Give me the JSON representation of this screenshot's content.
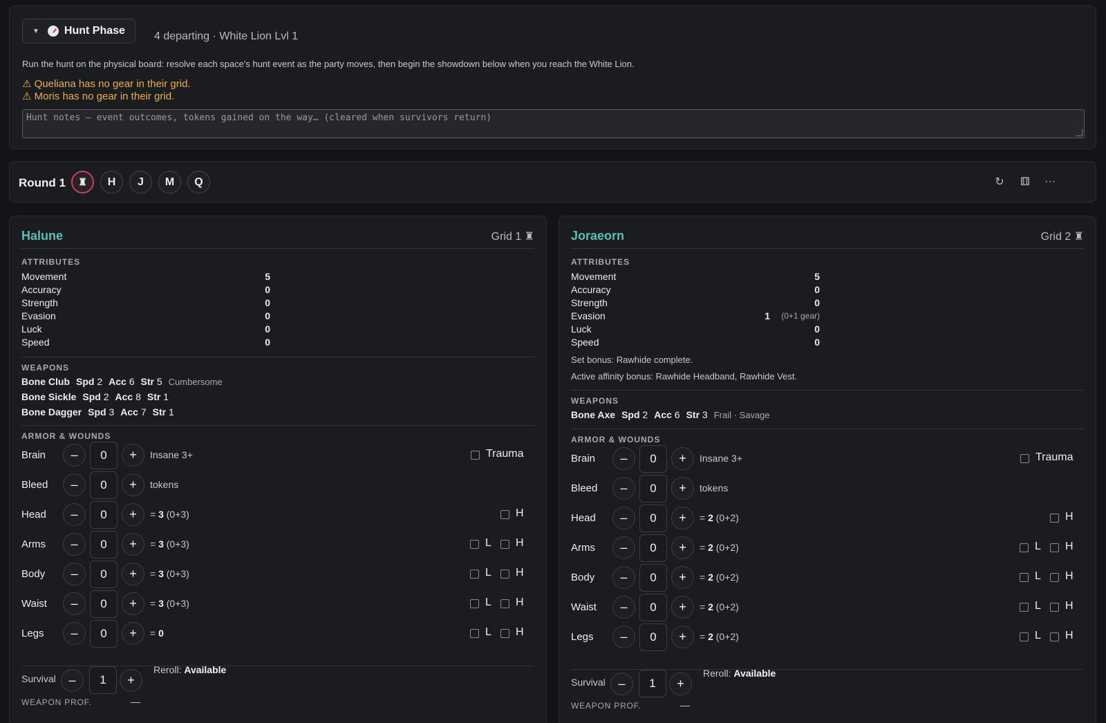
{
  "hunt": {
    "title": "Hunt Phase",
    "subtitle": "4 departing · White Lion Lvl 1",
    "description": "Run the hunt on the physical board: resolve each space's hunt event as the party moves, then begin the showdown below when you reach the White Lion.",
    "warnings": [
      "⚠ Queliana has no gear in their grid.",
      "⚠ Moris has no gear in their grid."
    ],
    "notes_placeholder": "Hunt notes — event outcomes, tokens gained on the way… (cleared when survivors return)"
  },
  "round": {
    "label": "Round 1",
    "chips": [
      "♜",
      "H",
      "J",
      "M",
      "Q"
    ],
    "icons": {
      "undo": "↻",
      "dice": "⚅",
      "more": "···"
    }
  },
  "labels": {
    "attributes": "ATTRIBUTES",
    "weapons": "WEAPONS",
    "armor": "ARMOR & WOUNDS",
    "survival": "Survival",
    "reroll": "Reroll:",
    "weapon_prof": "WEAPON PROF.",
    "minus": "–",
    "plus": "+",
    "trauma": "Trauma",
    "L": "L",
    "H": "H",
    "spd": "Spd",
    "acc": "Acc",
    "str": "Str"
  },
  "survivors": [
    {
      "name": "Halune",
      "grid": "Grid 1 ♜",
      "attributes": [
        {
          "name": "Movement",
          "value": "5"
        },
        {
          "name": "Accuracy",
          "value": "0"
        },
        {
          "name": "Strength",
          "value": "0"
        },
        {
          "name": "Evasion",
          "value": "0"
        },
        {
          "name": "Luck",
          "value": "0"
        },
        {
          "name": "Speed",
          "value": "0"
        }
      ],
      "weapons": [
        {
          "name": "Bone Club",
          "spd": "2",
          "acc": "6",
          "str": "5",
          "keywords": "Cumbersome"
        },
        {
          "name": "Bone Sickle",
          "spd": "2",
          "acc": "8",
          "str": "1",
          "keywords": ""
        },
        {
          "name": "Bone Dagger",
          "spd": "3",
          "acc": "7",
          "str": "1",
          "keywords": ""
        }
      ],
      "wounds": {
        "brain": {
          "value": "0",
          "text": "Insane 3+"
        },
        "bleed": {
          "value": "0",
          "text": "tokens"
        },
        "head": {
          "value": "0",
          "total": "3",
          "breakdown": "(0+3)"
        },
        "arms": {
          "value": "0",
          "total": "3",
          "breakdown": "(0+3)"
        },
        "body": {
          "value": "0",
          "total": "3",
          "breakdown": "(0+3)"
        },
        "waist": {
          "value": "0",
          "total": "3",
          "breakdown": "(0+3)"
        },
        "legs": {
          "value": "0",
          "total": "0",
          "breakdown": ""
        }
      },
      "survival": "1",
      "reroll": "Available",
      "weapon_prof": "—"
    },
    {
      "name": "Joraeorn",
      "grid": "Grid 2 ♜",
      "attributes": [
        {
          "name": "Movement",
          "value": "5"
        },
        {
          "name": "Accuracy",
          "value": "0"
        },
        {
          "name": "Strength",
          "value": "0"
        },
        {
          "name": "Evasion",
          "value": "1",
          "note": "(0+1 gear)"
        },
        {
          "name": "Luck",
          "value": "0"
        },
        {
          "name": "Speed",
          "value": "0"
        }
      ],
      "set_bonus": "Set bonus: Rawhide complete.",
      "affinity_bonus": "Active affinity bonus: Rawhide Headband, Rawhide Vest.",
      "weapons": [
        {
          "name": "Bone Axe",
          "spd": "2",
          "acc": "6",
          "str": "3",
          "keywords": "Frail · Savage"
        }
      ],
      "wounds": {
        "brain": {
          "value": "0",
          "text": "Insane 3+"
        },
        "bleed": {
          "value": "0",
          "text": "tokens"
        },
        "head": {
          "value": "0",
          "total": "2",
          "breakdown": "(0+2)"
        },
        "arms": {
          "value": "0",
          "total": "2",
          "breakdown": "(0+2)"
        },
        "body": {
          "value": "0",
          "total": "2",
          "breakdown": "(0+2)"
        },
        "waist": {
          "value": "0",
          "total": "2",
          "breakdown": "(0+2)"
        },
        "legs": {
          "value": "0",
          "total": "2",
          "breakdown": "(0+2)"
        }
      },
      "survival": "1",
      "reroll": "Available",
      "weapon_prof": "—"
    }
  ],
  "wound_labels": {
    "brain": "Brain",
    "bleed": "Bleed",
    "head": "Head",
    "arms": "Arms",
    "body": "Body",
    "waist": "Waist",
    "legs": "Legs"
  },
  "colors": {
    "accent_name": "#5bbfb5",
    "warning": "#e8b04b",
    "active_chip": "#c8425e"
  }
}
